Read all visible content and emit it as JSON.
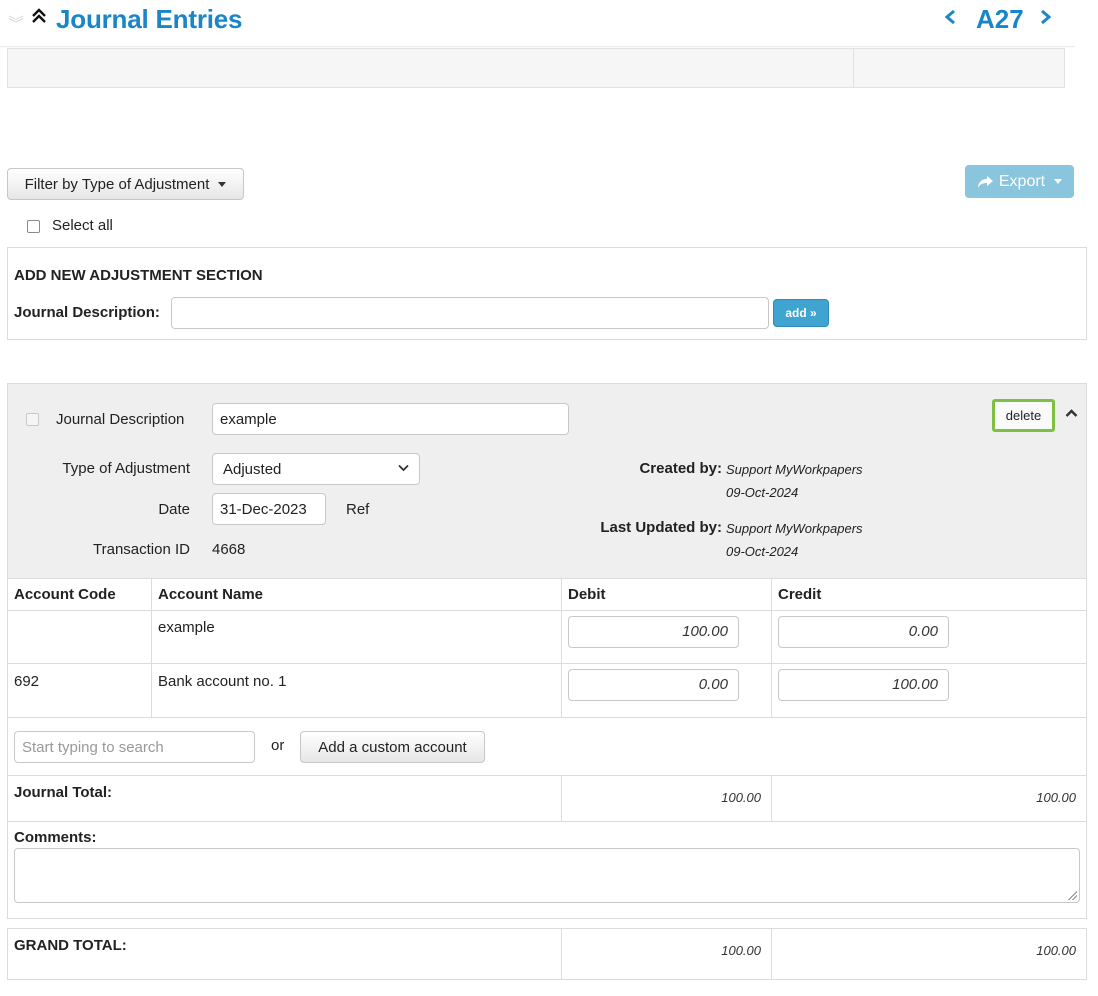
{
  "header": {
    "title": "Journal Entries",
    "code": "A27",
    "prev_icon": "chevron-left-icon",
    "next_icon": "chevron-right-icon",
    "collapse_all_icon": "double-chevron-down-icon",
    "expand_all_icon": "double-chevron-up-icon"
  },
  "toolbar": {
    "filter_label": "Filter by Type of Adjustment",
    "export_label": "Export",
    "export_icon": "share-icon",
    "select_all_label": "Select all",
    "select_all_checked": false
  },
  "add_section": {
    "heading": "ADD NEW ADJUSTMENT SECTION",
    "description_label": "Journal Description:",
    "description_value": "",
    "add_button": "add »"
  },
  "journal": {
    "description_label": "Journal Description",
    "description_value": "example",
    "type_label": "Type of Adjustment",
    "type_value": "Adjusted",
    "date_label": "Date",
    "date_value": "31-Dec-2023",
    "ref_label": "Ref",
    "transaction_label": "Transaction ID",
    "transaction_value": "4668",
    "created_by_label": "Created by:",
    "created_by_user": "Support MyWorkpapers",
    "created_date": "09-Oct-2024",
    "updated_by_label": "Last Updated by:",
    "updated_by_user": "Support MyWorkpapers",
    "updated_date": "09-Oct-2024",
    "delete_label": "delete",
    "collapse_icon": "chevron-up-icon",
    "columns": [
      "Account Code",
      "Account Name",
      "Debit",
      "Credit"
    ],
    "rows": [
      {
        "code": "",
        "name": "example",
        "debit": "100.00",
        "credit": "0.00"
      },
      {
        "code": "692",
        "name": "Bank account no. 1",
        "debit": "0.00",
        "credit": "100.00"
      }
    ],
    "search_placeholder": "Start typing to search",
    "or_label": "or",
    "custom_account_button": "Add a custom account",
    "total_label": "Journal Total:",
    "total_debit": "100.00",
    "total_credit": "100.00",
    "comments_label": "Comments:",
    "comments_value": ""
  },
  "grand_total": {
    "label": "GRAND TOTAL:",
    "debit": "100.00",
    "credit": "100.00"
  },
  "colors": {
    "brand_blue": "#1a86c8",
    "export_button": "#89c5dc",
    "add_button": "#3fa4cf",
    "delete_highlight": "#7dc142"
  }
}
